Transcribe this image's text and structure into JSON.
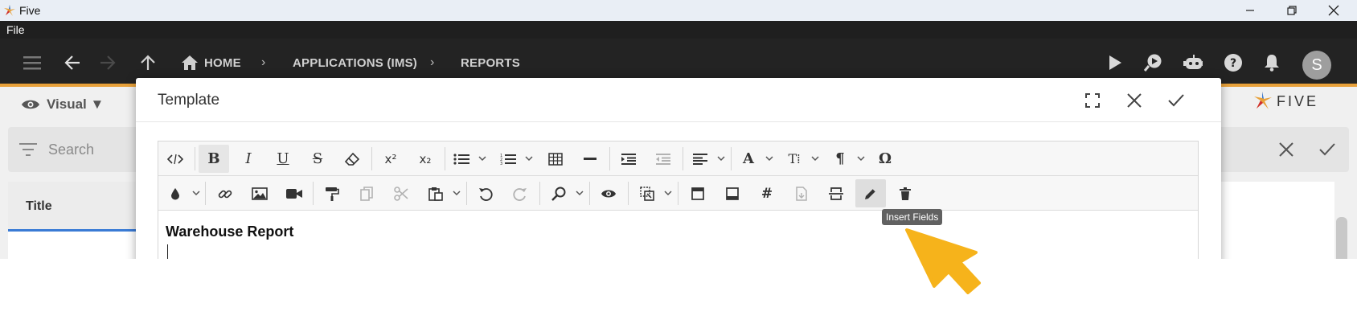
{
  "window": {
    "title": "Five"
  },
  "menubar": {
    "file_label": "File"
  },
  "nav": {
    "breadcrumbs": [
      {
        "label": "HOME",
        "icon": "home-icon"
      },
      {
        "label": "APPLICATIONS (IMS)"
      },
      {
        "label": "REPORTS"
      }
    ],
    "avatar_initial": "S",
    "accent_color": "#e8a13a"
  },
  "background": {
    "view_label": "Visual ▼",
    "search_placeholder": "Search",
    "column_title": "Title",
    "brand": "FIVE"
  },
  "modal": {
    "title": "Template",
    "editor": {
      "toolbar_row1": [
        "code-view",
        "bold",
        "italic",
        "underline",
        "strikethrough",
        "eraser",
        "superscript",
        "subscript",
        "bullet-list",
        "numbered-list",
        "table",
        "horizontal-rule",
        "indent",
        "outdent",
        "align",
        "font-color",
        "font-size",
        "paragraph",
        "special-char"
      ],
      "toolbar_row2": [
        "text-color",
        "link",
        "image",
        "video",
        "format-painter",
        "copy",
        "cut",
        "paste",
        "undo",
        "redo",
        "find",
        "preview",
        "select-all",
        "header",
        "footer",
        "hash",
        "export",
        "strike-box",
        "insert-fields",
        "delete"
      ],
      "content_heading": "Warehouse Report"
    },
    "tooltip": "Insert Fields"
  }
}
